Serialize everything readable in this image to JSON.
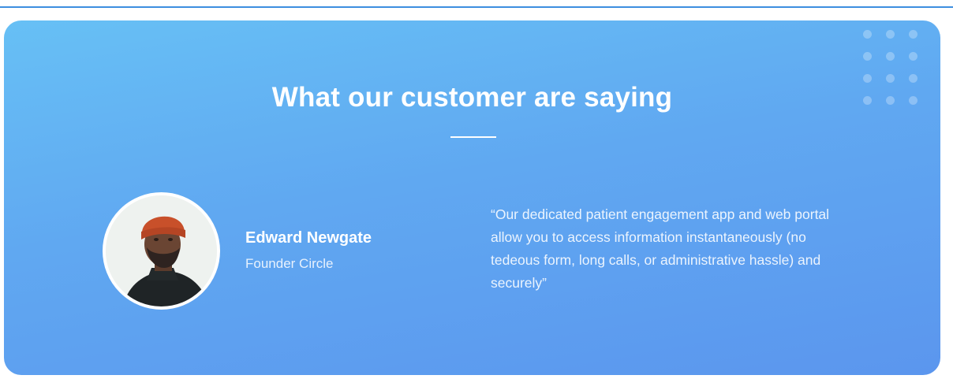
{
  "section": {
    "title": "What our customer are saying"
  },
  "testimonial": {
    "name": "Edward Newgate",
    "role": "Founder Circle",
    "quote": "“Our dedicated patient engagement app and web portal allow you to access information instantaneously (no tedeous form, long calls, or administrative hassle) and securely”"
  },
  "colors": {
    "gradient_top": "#67c0f5",
    "gradient_bottom": "#5b96ee",
    "top_rule": "#3d8ee0",
    "text": "#ffffff"
  },
  "icons": {
    "decoration": "dot-grid-icon"
  }
}
